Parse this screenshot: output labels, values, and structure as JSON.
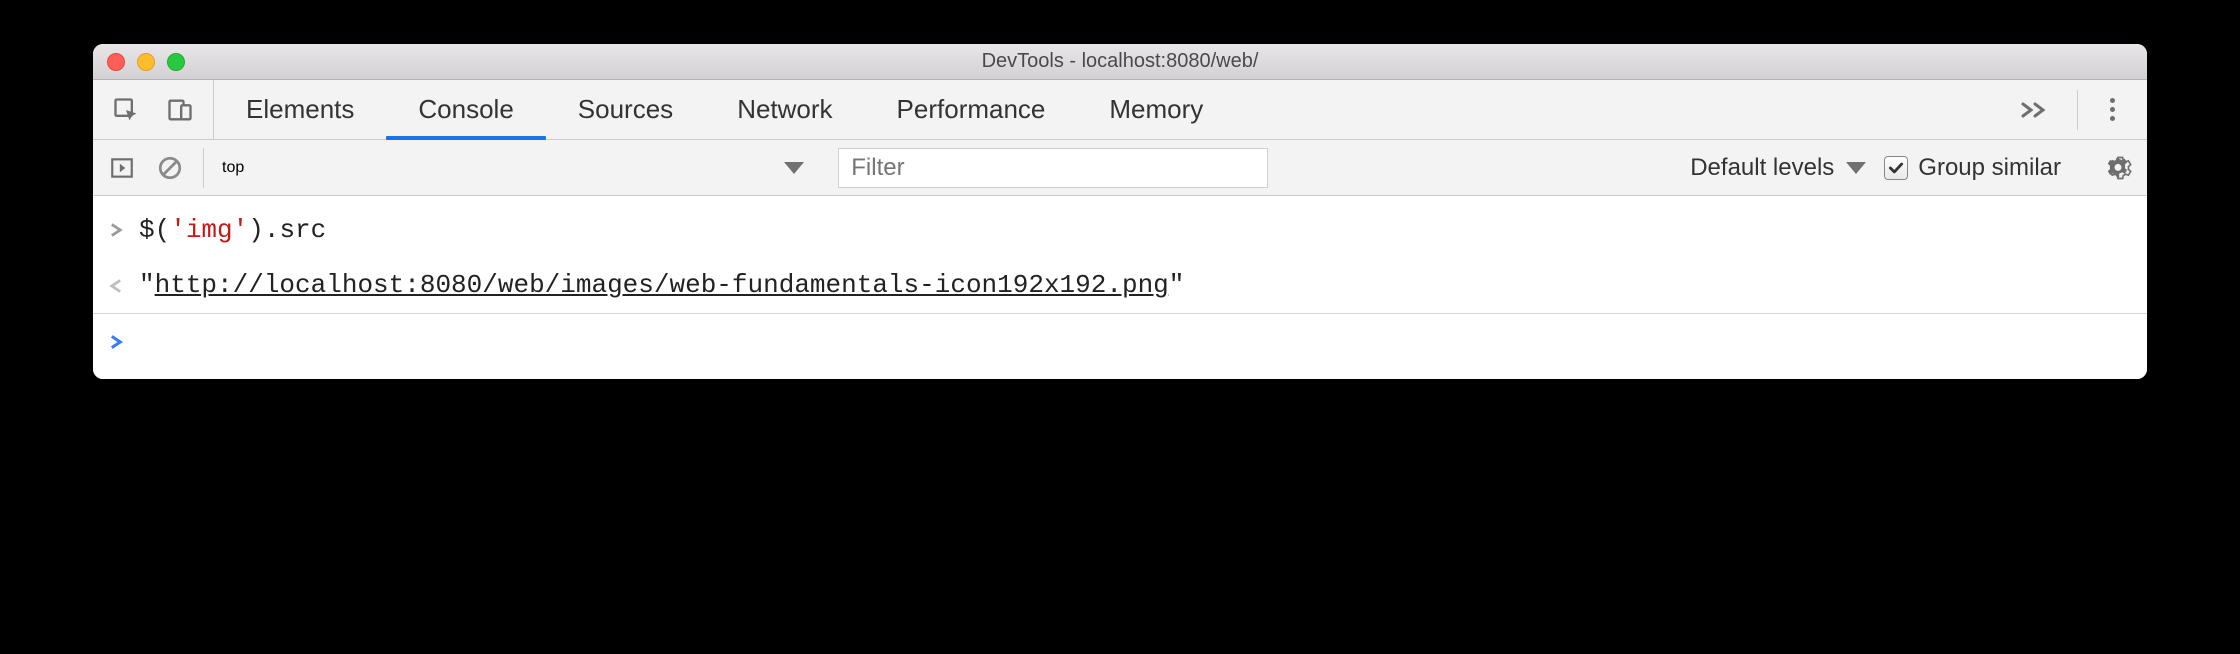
{
  "window": {
    "title": "DevTools - localhost:8080/web/"
  },
  "tabs": {
    "items": [
      {
        "label": "Elements",
        "active": false
      },
      {
        "label": "Console",
        "active": true
      },
      {
        "label": "Sources",
        "active": false
      },
      {
        "label": "Network",
        "active": false
      },
      {
        "label": "Performance",
        "active": false
      },
      {
        "label": "Memory",
        "active": false
      }
    ]
  },
  "toolbar": {
    "context": "top",
    "filter_placeholder": "Filter",
    "levels_label": "Default levels",
    "group_similar_label": "Group similar",
    "group_similar_checked": true
  },
  "console": {
    "input_code": {
      "prefix": "$(",
      "string": "'img'",
      "suffix": ").src"
    },
    "output_url": "http://localhost:8080/web/images/web-fundamentals-icon192x192.png"
  }
}
